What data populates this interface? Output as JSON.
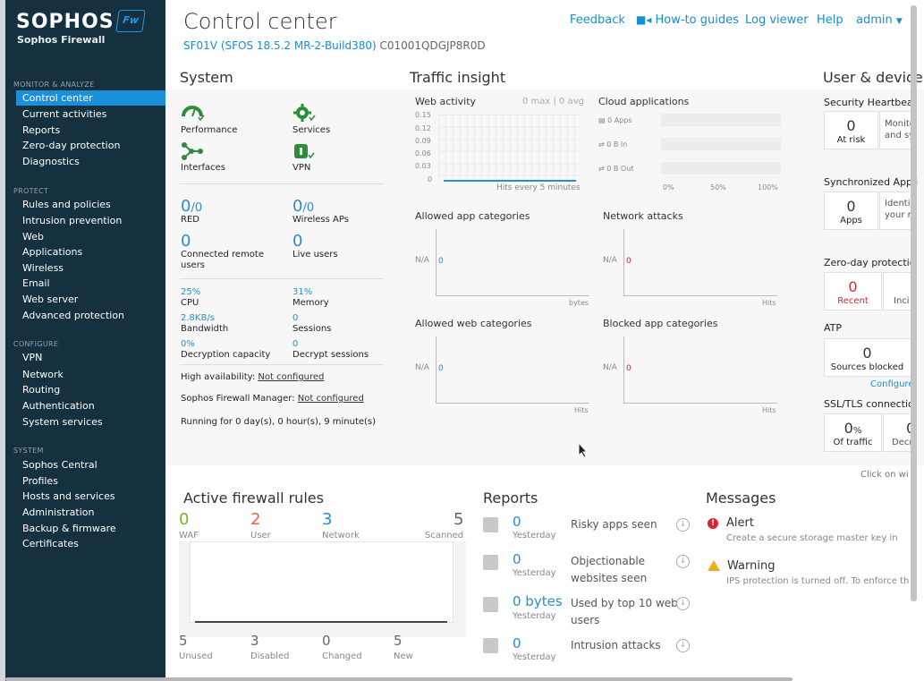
{
  "sidebar": {
    "logo": "SOPHOS",
    "logo_sub": "Sophos Firewall",
    "badge": "Fw",
    "sections": [
      {
        "title": "MONITOR & ANALYZE",
        "items": [
          "Control center",
          "Current activities",
          "Reports",
          "Zero-day protection",
          "Diagnostics"
        ]
      },
      {
        "title": "PROTECT",
        "items": [
          "Rules and policies",
          "Intrusion prevention",
          "Web",
          "Applications",
          "Wireless",
          "Email",
          "Web server",
          "Advanced protection"
        ]
      },
      {
        "title": "CONFIGURE",
        "items": [
          "VPN",
          "Network",
          "Routing",
          "Authentication",
          "System services"
        ]
      },
      {
        "title": "SYSTEM",
        "items": [
          "Sophos Central",
          "Profiles",
          "Hosts and services",
          "Administration",
          "Backup & firmware",
          "Certificates"
        ]
      }
    ]
  },
  "header": {
    "title": "Control center",
    "fw_link": "SF01V (SFOS 18.5.2 MR-2-Build380)",
    "serial": "C01001QDGJP8R0D",
    "links": {
      "feedback": "Feedback",
      "howto": "How-to guides",
      "logviewer": "Log viewer",
      "help": "Help",
      "admin": "admin"
    }
  },
  "system": {
    "title": "System",
    "icons": {
      "performance": "Performance",
      "services": "Services",
      "interfaces": "Interfaces",
      "vpn": "VPN"
    },
    "red_val": "0",
    "red_total": "/0",
    "red_label": "RED",
    "wap_val": "0",
    "wap_total": "/0",
    "wap_label": "Wireless APs",
    "remote_val": "0",
    "remote_label1": "Connected remote",
    "remote_label2": "users",
    "live_val": "0",
    "live_label": "Live users",
    "cpu_val": "25%",
    "cpu_label": "CPU",
    "mem_val": "31%",
    "mem_label": "Memory",
    "bw_val": "2.8KB/s",
    "bw_label": "Bandwidth",
    "sess_val": "0",
    "sess_label": "Sessions",
    "dec_val": "0%",
    "dec_label": "Decryption capacity",
    "decs_val": "0",
    "decs_label": "Decrypt sessions",
    "ha_label": "High availability:",
    "ha_val": "Not configured",
    "sfm_label": "Sophos Firewall Manager:",
    "sfm_val": "Not configured",
    "running": "Running for 0 day(s), 0 hour(s), 9 minute(s)"
  },
  "traffic": {
    "title": "Traffic insight",
    "web_title": "Web activity",
    "web_stats": "0 max | 0 avg",
    "web_ticks": [
      "0.15",
      "0.12",
      "0.09",
      "0.06",
      "0.03",
      "0"
    ],
    "web_footer": "Hits every 5 minutes",
    "cloud_title": "Cloud applications",
    "cloud_rows": [
      "0 Apps",
      "0 B In",
      "0 B Out"
    ],
    "cloud_ticks": [
      "0%",
      "50%",
      "100%"
    ],
    "allowed_app": "Allowed app categories",
    "net_attacks": "Network attacks",
    "allowed_web": "Allowed web categories",
    "blocked_app": "Blocked app categories",
    "na": "N/A",
    "zero": "0",
    "bytes": "bytes",
    "hits": "Hits",
    "click_hint": "Click on wi"
  },
  "userdev": {
    "title": "User & device",
    "hb_title": "Security Heartbeat",
    "hb_val": "0",
    "hb_label": "At risk",
    "hb_side1": "Monito",
    "hb_side2": "and sy",
    "sa_title": "Synchronized Appli",
    "sa_val": "0",
    "sa_label": "Apps",
    "sa_side1": "Identi",
    "sa_side2": "your n",
    "zd_title": "Zero-day protectio",
    "zd_val": "0",
    "zd_label": "Recent",
    "zd_side": "Inci",
    "atp_title": "ATP",
    "atp_val": "0",
    "atp_label": "Sources blocked",
    "atp_link": "Configure",
    "ssl_title": "SSL/TLS connectio",
    "ssl_val": "0",
    "ssl_pct": "%",
    "ssl_label": "Of traffic",
    "ssl_side_val": "0",
    "ssl_side": "Decr"
  },
  "fwrules": {
    "title": "Active firewall rules",
    "waf_val": "0",
    "waf": "WAF",
    "user_val": "2",
    "user": "User",
    "net_val": "3",
    "net": "Network",
    "scan_val": "5",
    "scan": "Scanned",
    "unused_val": "5",
    "unused": "Unused",
    "dis_val": "3",
    "dis": "Disabled",
    "chg_val": "0",
    "chg": "Changed",
    "new_val": "5",
    "new": "New"
  },
  "reports": {
    "title": "Reports",
    "rows": [
      {
        "val": "0",
        "when": "Yesterday",
        "label1": "Risky apps seen",
        "label2": ""
      },
      {
        "val": "0",
        "when": "Yesterday",
        "label1": "Objectionable",
        "label2": "websites seen"
      },
      {
        "val": "0 bytes",
        "when": "Yesterday",
        "label1": "Used by top 10 web",
        "label2": "users"
      },
      {
        "val": "0",
        "when": "Yesterday",
        "label1": "Intrusion attacks",
        "label2": ""
      }
    ]
  },
  "messages": {
    "title": "Messages",
    "alert_title": "Alert",
    "alert_text": "Create a secure storage master key in",
    "warn_title": "Warning",
    "warn_text": "IPS protection is turned off. To enforce th"
  },
  "colors": {
    "sidebar": "#15303f",
    "accent": "#1b8fd9",
    "link": "#1a8cd4",
    "green": "#2e8b3a",
    "orange": "#e8663d",
    "red": "#d9262f"
  }
}
